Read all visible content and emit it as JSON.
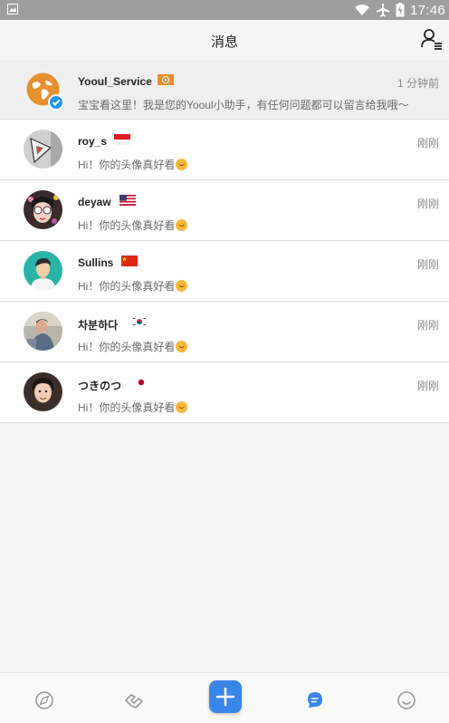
{
  "status_bar": {
    "time": "17:46"
  },
  "header": {
    "title": "消息"
  },
  "conversations": [
    {
      "name": "Yooul_Service",
      "time": "1 分钟前",
      "message": "宝宝看这里！我是您的Yooul小助手，有任何问题都可以留言给我哦～",
      "flag": "UN",
      "pinned": true
    },
    {
      "name": "roy_s",
      "time": "刚刚",
      "message": "Hi！你的头像真好看",
      "flag": "ID"
    },
    {
      "name": "deyaw",
      "time": "刚刚",
      "message": "Hi！你的头像真好看",
      "flag": "US"
    },
    {
      "name": "Sullins",
      "time": "刚刚",
      "message": "Hi！你的头像真好看",
      "flag": "CN"
    },
    {
      "name": "차분하다",
      "time": "刚刚",
      "message": "Hi！你的头像真好看",
      "flag": "KR"
    },
    {
      "name": "つきのつ",
      "time": "刚刚",
      "message": "Hi！你的头像真好看",
      "flag": "JP"
    }
  ],
  "bottom_nav": {
    "items": [
      "compass-icon",
      "handshake-icon",
      "plus-icon",
      "chat-icon",
      "smile-icon"
    ],
    "active": "chat-icon"
  },
  "colors": {
    "accent": "#3a86e8",
    "verified": "#2196f3",
    "un_flag": "#e6902f"
  }
}
